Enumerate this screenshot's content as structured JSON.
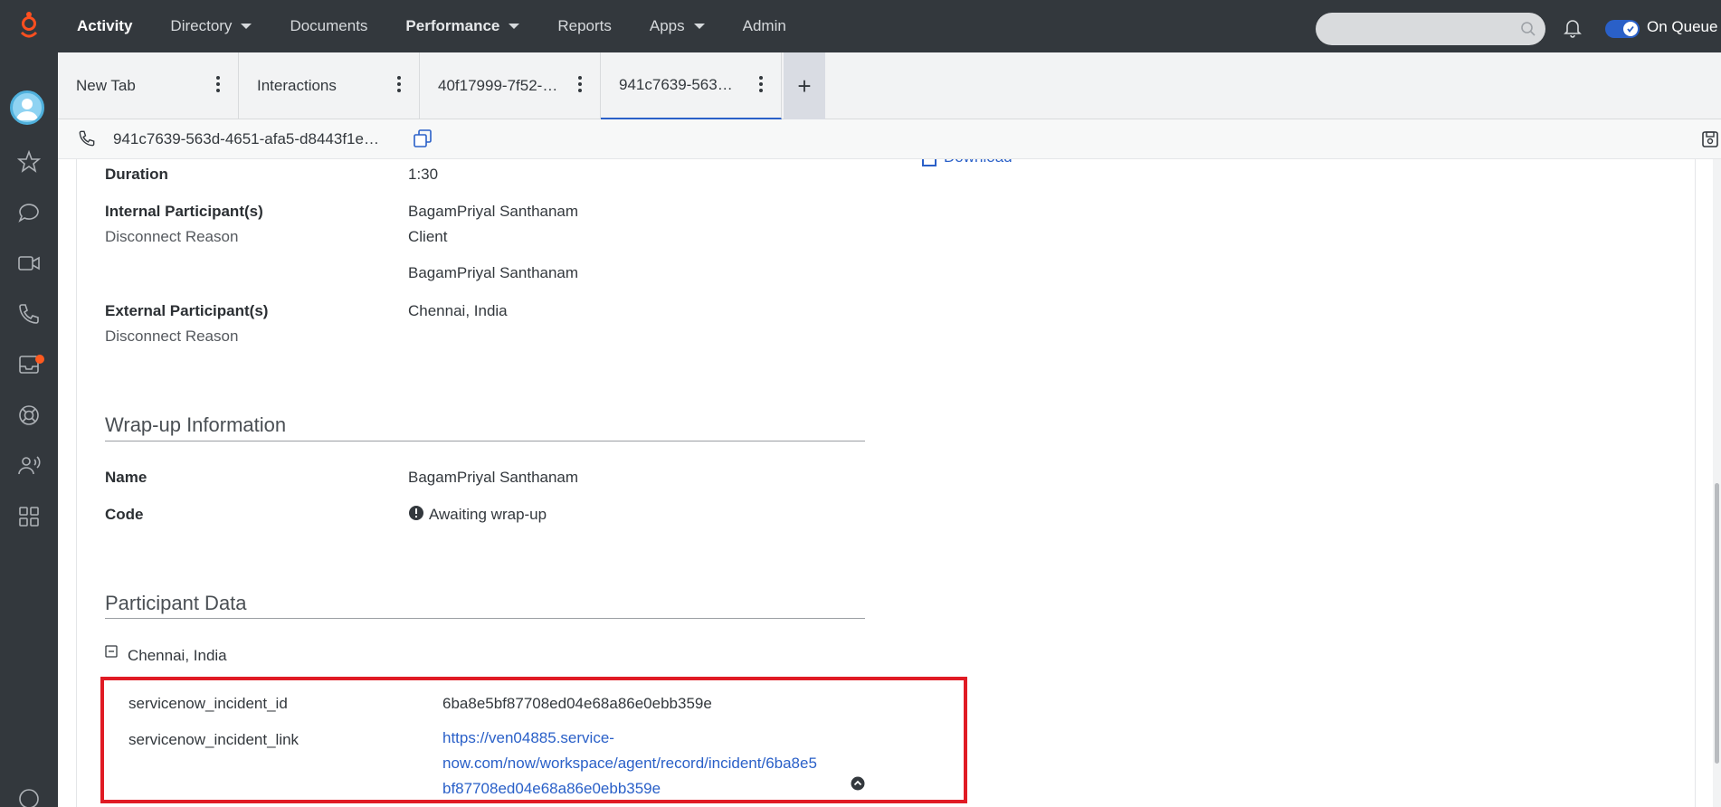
{
  "topnav": {
    "items": [
      {
        "label": "Activity",
        "style": "bold"
      },
      {
        "label": "Directory",
        "dropdown": true
      },
      {
        "label": "Documents"
      },
      {
        "label": "Performance",
        "dropdown": true,
        "style": "semibold"
      },
      {
        "label": "Reports"
      },
      {
        "label": "Apps",
        "dropdown": true
      },
      {
        "label": "Admin"
      }
    ],
    "search_placeholder": "",
    "on_queue_label": "On Queue",
    "on_queue_enabled": true,
    "accent": "#2a60c8",
    "logo_color": "#ff4f1f"
  },
  "rail": {
    "icons": [
      "avatar",
      "star-icon",
      "chat-icon",
      "video-icon",
      "phone-icon",
      "inbox-icon",
      "support-icon",
      "people-speaking-icon",
      "apps-grid-icon",
      "help-icon"
    ],
    "inbox_badge_color": "#ff5a1f"
  },
  "tabs": [
    {
      "label": "New Tab",
      "active": false
    },
    {
      "label": "Interactions",
      "active": false
    },
    {
      "label": "40f17999-7f52-…",
      "active": false
    },
    {
      "label": "941c7639-563…",
      "active": true
    }
  ],
  "subheader": {
    "conversation_id": "941c7639-563d-4651-afa5-d8443f1e…"
  },
  "details": {
    "download_label": "Download",
    "duration_label": "Duration",
    "duration_value": "1:30",
    "internal_label": "Internal Participant(s)",
    "internal_name": "BagamPriyal Santhanam",
    "internal_disconnect_label": "Disconnect Reason",
    "internal_disconnect_value": "Client",
    "internal_name_2": "BagamPriyal Santhanam",
    "external_label": "External Participant(s)",
    "external_name": "Chennai, India",
    "external_disconnect_label": "Disconnect Reason"
  },
  "wrapup": {
    "title": "Wrap-up Information",
    "name_label": "Name",
    "name_value": "BagamPriyal Santhanam",
    "code_label": "Code",
    "code_value": "Awaiting wrap-up"
  },
  "participant_data": {
    "title": "Participant Data",
    "group_label": "Chennai, India",
    "rows": [
      {
        "key": "servicenow_incident_id",
        "value": "6ba8e5bf87708ed04e68a86e0ebb359e"
      },
      {
        "key": "servicenow_incident_link",
        "value": "https://ven04885.service-now.com/now/workspace/agent/record/incident/6ba8e5bf87708ed04e68a86e0ebb359e"
      }
    ],
    "link_lines": [
      "https://ven04885.service-",
      "now.com/now/workspace/agent/record/incident/6ba8e5",
      "bf87708ed04e68a86e0ebb359e"
    ],
    "highlight_color": "#e01b24"
  }
}
